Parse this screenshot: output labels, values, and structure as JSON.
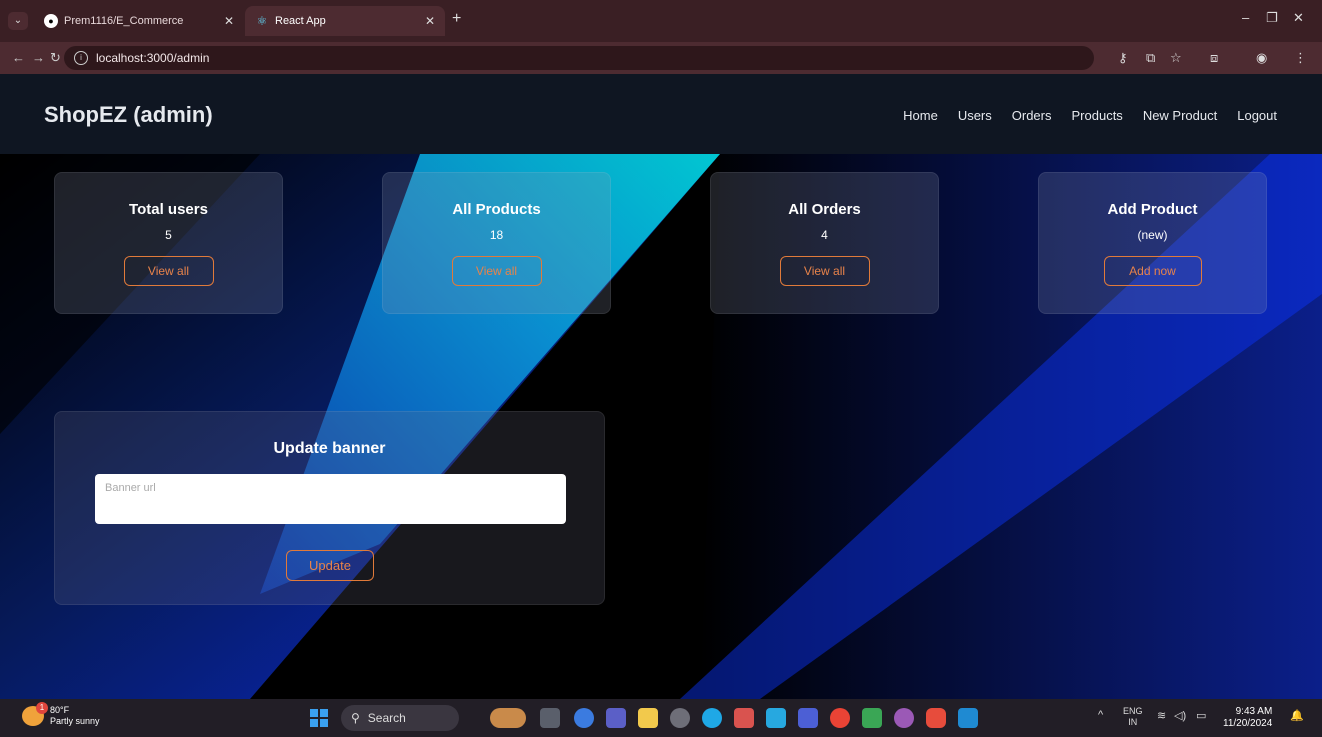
{
  "browser": {
    "tabs": [
      {
        "label": "Prem1116/E_Commerce",
        "active": false
      },
      {
        "label": "React App",
        "active": true
      }
    ],
    "url": "localhost:3000/admin"
  },
  "navbar": {
    "brand": "ShopEZ (admin)",
    "links": [
      "Home",
      "Users",
      "Orders",
      "Products",
      "New Product",
      "Logout"
    ]
  },
  "cards": [
    {
      "title": "Total users",
      "value": "5",
      "button": "View all"
    },
    {
      "title": "All Products",
      "value": "18",
      "button": "View all"
    },
    {
      "title": "All Orders",
      "value": "4",
      "button": "View all"
    },
    {
      "title": "Add Product",
      "value": "(new)",
      "button": "Add now"
    }
  ],
  "banner": {
    "title": "Update banner",
    "input_placeholder": "Banner url",
    "input_value": "",
    "button": "Update"
  },
  "taskbar": {
    "weather_temp": "80°F",
    "weather_desc": "Partly sunny",
    "weather_badge": "1",
    "search_label": "Search",
    "lang_top": "ENG",
    "lang_bottom": "IN",
    "time": "9:43 AM",
    "date": "11/20/2024"
  },
  "colors": {
    "accent": "#e8834a",
    "navbar_bg": "#0f1622",
    "chrome_bg": "#3a1f24"
  }
}
